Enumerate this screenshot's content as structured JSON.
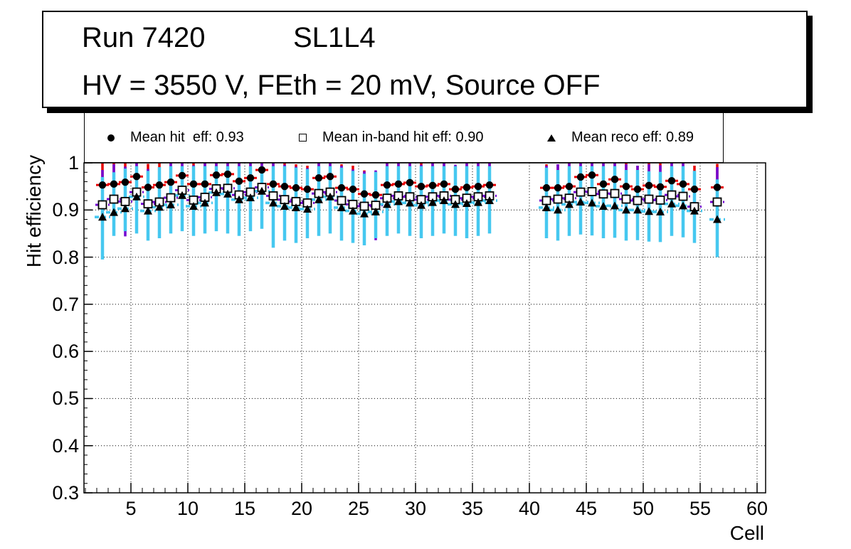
{
  "title_box": {
    "run": "Run 7420",
    "layer": "SL1L4",
    "conditions": "HV = 3550 V, FEth = 20 mV, Source OFF"
  },
  "legend": {
    "entries": [
      {
        "marker": "filled-circle-icon",
        "label": "Mean hit  eff: 0.93"
      },
      {
        "marker": "open-square-icon",
        "label": "Mean in-band hit eff: 0.90"
      },
      {
        "marker": "filled-triangle-icon",
        "label": "Mean reco eff: 0.89"
      }
    ]
  },
  "axes": {
    "y_label": "Hit efficiency",
    "x_label": "Cell",
    "y_ticks": [
      "1",
      "0.9",
      "0.8",
      "0.7",
      "0.6",
      "0.5",
      "0.4",
      "0.3"
    ],
    "x_ticks": [
      "5",
      "10",
      "15",
      "20",
      "25",
      "30",
      "35",
      "40",
      "45",
      "50",
      "55",
      "60"
    ]
  },
  "colors": {
    "marker": "#000000",
    "hit_error": "#e60000",
    "inband_error": "#7300d1",
    "reco_error": "#46c8f0",
    "grid": "#000000",
    "frame": "#000000"
  },
  "chart_data": {
    "type": "scatter",
    "title": "Run 7420 SL1L4  HV = 3550 V, FEth = 20 mV, Source OFF",
    "xlabel": "Cell",
    "ylabel": "Hit efficiency",
    "xlim": [
      0.875,
      60.75
    ],
    "ylim": [
      0.3,
      1.0
    ],
    "grid": "dotted",
    "legend_position": "top",
    "cells": [
      2,
      3,
      4,
      5,
      6,
      7,
      8,
      9,
      10,
      11,
      12,
      13,
      14,
      15,
      16,
      17,
      18,
      19,
      20,
      21,
      22,
      23,
      24,
      25,
      26,
      27,
      28,
      29,
      30,
      31,
      32,
      33,
      34,
      35,
      36,
      41,
      42,
      43,
      44,
      45,
      46,
      47,
      48,
      49,
      50,
      51,
      52,
      53,
      54,
      56
    ],
    "series": [
      {
        "name": "Mean hit eff",
        "mean": 0.93,
        "marker": "filled-circle",
        "values": [
          0.953,
          0.955,
          0.959,
          0.971,
          0.948,
          0.953,
          0.959,
          0.973,
          0.955,
          0.955,
          0.974,
          0.976,
          0.961,
          0.968,
          0.985,
          0.955,
          0.95,
          0.947,
          0.944,
          0.968,
          0.971,
          0.947,
          0.944,
          0.934,
          0.932,
          0.953,
          0.955,
          0.958,
          0.95,
          0.952,
          0.955,
          0.944,
          0.948,
          0.95,
          0.953,
          0.947,
          0.947,
          0.95,
          0.97,
          0.974,
          0.955,
          0.965,
          0.95,
          0.944,
          0.952,
          0.949,
          0.962,
          0.955,
          0.944,
          0.948
        ],
        "err_half": 0.05
      },
      {
        "name": "Mean in-band hit eff",
        "mean": 0.9,
        "marker": "open-square",
        "values": [
          0.911,
          0.923,
          0.918,
          0.938,
          0.913,
          0.917,
          0.926,
          0.942,
          0.921,
          0.927,
          0.945,
          0.946,
          0.932,
          0.938,
          0.948,
          0.93,
          0.922,
          0.918,
          0.915,
          0.935,
          0.938,
          0.92,
          0.912,
          0.908,
          0.91,
          0.925,
          0.93,
          0.928,
          0.922,
          0.928,
          0.93,
          0.922,
          0.925,
          0.928,
          0.93,
          0.92,
          0.923,
          0.925,
          0.938,
          0.939,
          0.934,
          0.935,
          0.923,
          0.92,
          0.923,
          0.921,
          0.932,
          0.929,
          0.907,
          0.917
        ],
        "err_half": 0.074
      },
      {
        "name": "Mean reco eff",
        "mean": 0.89,
        "marker": "filled-triangle",
        "values": [
          0.885,
          0.895,
          0.903,
          0.928,
          0.898,
          0.906,
          0.911,
          0.931,
          0.908,
          0.915,
          0.937,
          0.934,
          0.922,
          0.926,
          0.94,
          0.915,
          0.908,
          0.905,
          0.902,
          0.922,
          0.928,
          0.905,
          0.898,
          0.892,
          0.896,
          0.912,
          0.918,
          0.915,
          0.91,
          0.916,
          0.92,
          0.912,
          0.914,
          0.916,
          0.92,
          0.905,
          0.9,
          0.912,
          0.917,
          0.915,
          0.908,
          0.909,
          0.9,
          0.9,
          0.897,
          0.896,
          0.913,
          0.909,
          0.898,
          0.88
        ],
        "err_up": 0.085,
        "err_low_to": [
          0.795,
          0.845,
          0.855,
          0.85,
          0.835,
          0.84,
          0.85,
          0.855,
          0.845,
          0.85,
          0.855,
          0.85,
          0.845,
          0.855,
          0.86,
          0.82,
          0.835,
          0.83,
          0.84,
          0.845,
          0.85,
          0.835,
          0.83,
          0.825,
          0.84,
          0.845,
          0.85,
          0.845,
          0.84,
          0.845,
          0.85,
          0.845,
          0.84,
          0.845,
          0.85,
          0.84,
          0.835,
          0.845,
          0.848,
          0.846,
          0.84,
          0.841,
          0.835,
          0.836,
          0.833,
          0.832,
          0.845,
          0.842,
          0.83,
          0.8
        ]
      }
    ]
  }
}
